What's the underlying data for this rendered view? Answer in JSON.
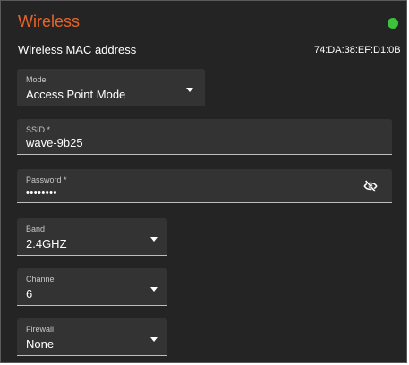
{
  "section": {
    "title": "Wireless",
    "status_color": "#3cc23c"
  },
  "mac": {
    "label": "Wireless MAC address",
    "value": "74:DA:38:EF:D1:0B"
  },
  "fields": {
    "mode": {
      "label": "Mode",
      "value": "Access Point Mode",
      "type": "select"
    },
    "ssid": {
      "label": "SSID *",
      "value": "wave-9b25",
      "type": "text"
    },
    "password": {
      "label": "Password *",
      "value": "••••••••",
      "type": "password",
      "toggle_icon": "eye-slash-icon"
    },
    "band": {
      "label": "Band",
      "value": "2.4GHZ",
      "type": "select"
    },
    "channel": {
      "label": "Channel",
      "value": "6",
      "type": "select"
    },
    "firewall": {
      "label": "Firewall",
      "value": "None",
      "type": "select"
    }
  },
  "colors": {
    "accent": "#e8642a",
    "panel_bg": "#242424",
    "field_bg": "#333333",
    "text": "#ffffff"
  }
}
